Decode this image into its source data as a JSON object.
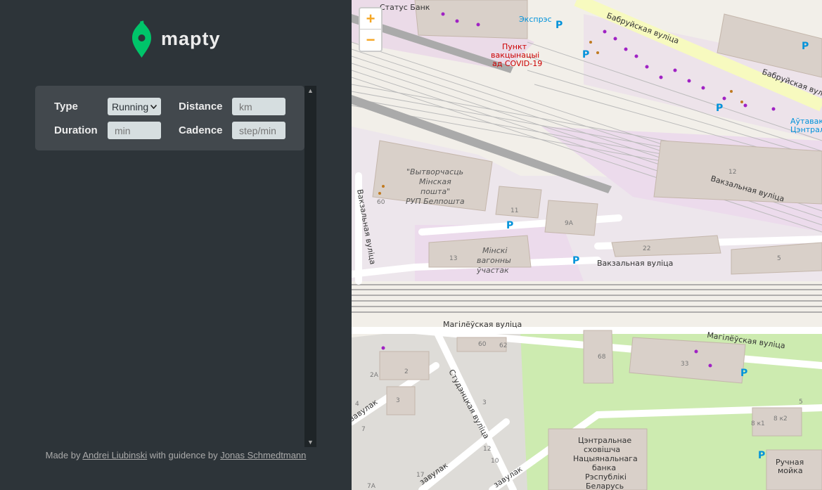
{
  "app": {
    "name": "mapty"
  },
  "form": {
    "type_label": "Type",
    "type_value": "Running",
    "distance_label": "Distance",
    "distance_placeholder": "km",
    "duration_label": "Duration",
    "duration_placeholder": "min",
    "cadence_label": "Cadence",
    "cadence_placeholder": "step/min"
  },
  "footer": {
    "made_by": "Made by",
    "author": "Andrei Liubinski",
    "with_guidance": "with guidence by",
    "mentor": "Jonas Schmedtmann"
  },
  "map": {
    "zoom_in": "+",
    "zoom_out": "−",
    "labels": {
      "bank": "Статус Банк",
      "express": "Экспрэс",
      "vaccination_1": "Пункт",
      "vaccination_2": "вакцынацыі",
      "vaccination_3": "ад COVID-19",
      "babruiskaya_1": "Бабруйская вуліца",
      "babruiskaya_2": "Бабруйская вуліца",
      "bus_station_1": "Аўтавакз",
      "bus_station_2": "Цэнтральн",
      "post_1": "\"Вытворчасць",
      "post_2": "Мінская",
      "post_3": "пошта\"",
      "post_4": "РУП Белпошта",
      "vakzalnaya_1": "Вакзальная вуліца",
      "vakzalnaya_2": "Вакзальная вуліца",
      "vakzalnaya_3": "Вакзальная вуліца",
      "wagon_1": "Мінскі",
      "wagon_2": "вагонны",
      "wagon_3": "ўчастак",
      "mahiliouskaya_1": "Магілёўская вуліца",
      "mahiliouskaya_2": "Магілёўская вуліца",
      "studentskaya": "Студэнцкая вуліца",
      "zavulak_1": "завулак",
      "zavulak_2": "завулак",
      "zavulak_3": "завулак",
      "nbrb_1": "Цэнтральнае",
      "nbrb_2": "сховішча",
      "nbrb_3": "Нацыянальнага",
      "nbrb_4": "банка",
      "nbrb_5": "Рэспублікі",
      "nbrb_6": "Беларусь",
      "carwash_1": "Ручная",
      "carwash_2": "мойка",
      "n12": "12",
      "n11": "11",
      "n9a": "9А",
      "n22": "22",
      "n13": "13",
      "n5": "5",
      "n60": "60",
      "n60b": "60",
      "n62": "62",
      "n68": "68",
      "n33": "33",
      "n2a": "2А",
      "n2": "2",
      "n3": "3",
      "n4": "4",
      "n3b": "3",
      "n12b": "12",
      "n10": "10",
      "n7": "7",
      "n17": "17",
      "n7a": "7А",
      "n8k1": "8 к1",
      "n8k2": "8 к2",
      "n5b": "5"
    }
  },
  "colors": {
    "sidebar_bg": "#2d3439",
    "panel_bg": "#42484d",
    "brand_green": "#00c46a",
    "accent_orange": "#f5a623"
  }
}
